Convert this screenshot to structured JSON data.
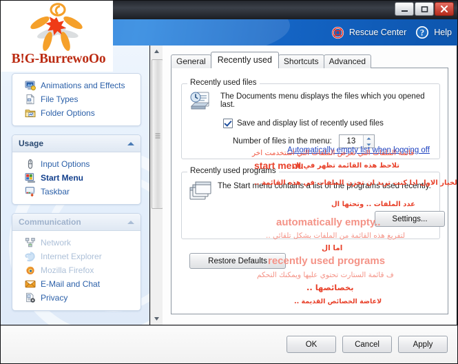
{
  "window": {
    "minimize_label": "Minimize",
    "maximize_label": "Maximize",
    "close_label": "Close"
  },
  "banner": {
    "rescue_center": "Rescue Center",
    "help": "Help"
  },
  "brand": {
    "logo_text": "B!G-BurrewoOo"
  },
  "sidebar": {
    "groups": [
      {
        "title": "",
        "items": [
          {
            "label": "Animations and Effects",
            "icon": "monitor-effects-icon",
            "state": "normal"
          },
          {
            "label": "File Types",
            "icon": "file-types-icon",
            "state": "normal"
          },
          {
            "label": "Folder Options",
            "icon": "folder-options-icon",
            "state": "normal"
          }
        ]
      },
      {
        "title": "Usage",
        "items": [
          {
            "label": "Input Options",
            "icon": "mouse-icon",
            "state": "normal"
          },
          {
            "label": "Start Menu",
            "icon": "start-menu-icon",
            "state": "active"
          },
          {
            "label": "Taskbar",
            "icon": "taskbar-icon",
            "state": "normal"
          }
        ]
      },
      {
        "title": "Communication",
        "items": [
          {
            "label": "Network",
            "icon": "network-icon",
            "state": "ghost"
          },
          {
            "label": "Internet Explorer",
            "icon": "internet-explorer-icon",
            "state": "ghost"
          },
          {
            "label": "Mozilla Firefox",
            "icon": "firefox-icon",
            "state": "ghost"
          },
          {
            "label": "E-Mail and Chat",
            "icon": "envelope-icon",
            "state": "normal"
          },
          {
            "label": "Privacy",
            "icon": "privacy-icon",
            "state": "normal"
          }
        ]
      }
    ]
  },
  "tabs": [
    {
      "label": "General",
      "selected": false
    },
    {
      "label": "Recently used",
      "selected": true
    },
    {
      "label": "Shortcuts",
      "selected": false
    },
    {
      "label": "Advanced",
      "selected": false
    }
  ],
  "recently_used_files": {
    "legend": "Recently used files",
    "description": "The Documents menu displays the files which you opened last.",
    "checkbox_label": "Save and display list of recently used files",
    "checkbox_checked": true,
    "spinner_label": "Number of files in the menu:",
    "spinner_value": "13",
    "link": "Automatically empty list when logging off"
  },
  "recently_used_programs": {
    "legend": "Recently used programs",
    "description": "The Start menu contains a list of the programs used recently.",
    "settings_button": "Settings..."
  },
  "buttons": {
    "restore_defaults": "Restore Defaults",
    "ok": "OK",
    "cancel": "Cancel",
    "apply": "Apply"
  },
  "annotations": [
    {
      "text": "قائمة الملفات التي تعرض الملفات التي استخدمت اخر",
      "kind": "ar"
    },
    {
      "text": "تلاحظ هذه القائمة تظهر في ال",
      "kind": "ar"
    },
    {
      "text": "start menu",
      "kind": "en"
    },
    {
      "text": "الخيار الاول ادا كنت تريد ان تخزن الملفات في هذه القائمة ..",
      "kind": "ar"
    },
    {
      "text": "عدد الملفات .. وتحتها ال",
      "kind": "ar"
    },
    {
      "text": "automatically empty..",
      "kind": "en"
    },
    {
      "text": "لتفريغ هذه القائمة من الملفات بشكل تلقائي ..",
      "kind": "ar"
    },
    {
      "text": "اما ال",
      "kind": "ar"
    },
    {
      "text": "recently used programs",
      "kind": "en"
    },
    {
      "text": "ف قائمة الستارت تحتوي عليها ويمكنك التحكم",
      "kind": "ar"
    },
    {
      "text": "بخصائصها ..",
      "kind": "ar"
    },
    {
      "text": "لاعاضة الخصائص القديمة ..",
      "kind": "ar"
    }
  ]
}
